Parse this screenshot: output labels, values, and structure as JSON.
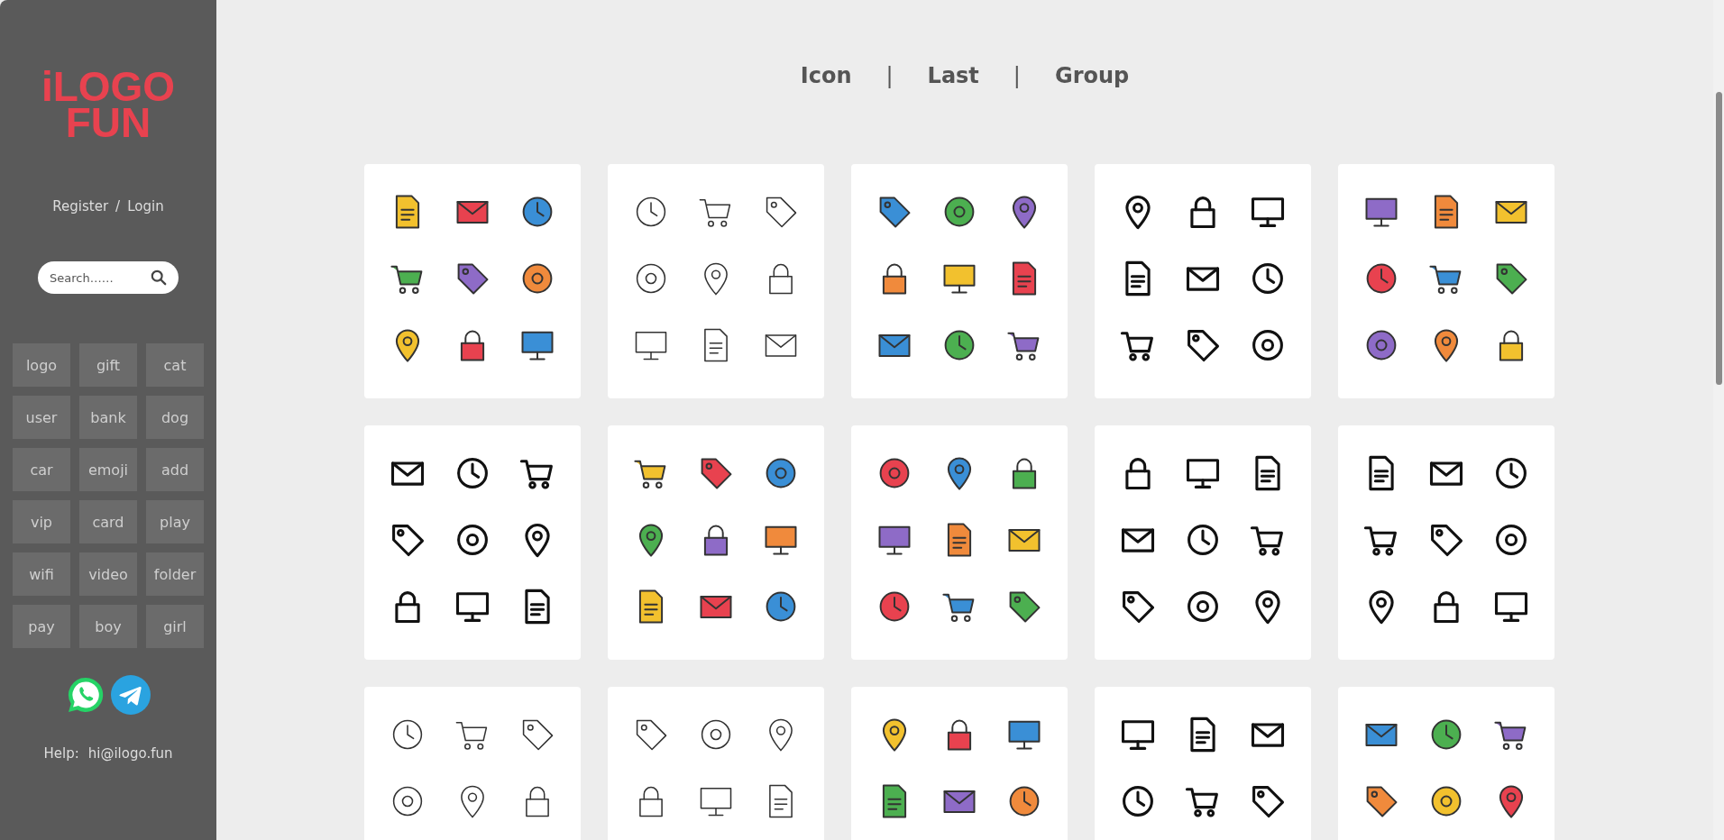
{
  "sidebar": {
    "logo": [
      "iLOGO",
      "FUN"
    ],
    "account": {
      "register": "Register",
      "separator": "/",
      "login": "Login"
    },
    "search": {
      "placeholder": "Search……"
    },
    "tags": [
      "logo",
      "gift",
      "cat",
      "user",
      "bank",
      "dog",
      "car",
      "emoji",
      "add",
      "vip",
      "card",
      "play",
      "wifi",
      "video",
      "folder",
      "pay",
      "boy",
      "girl"
    ],
    "help": {
      "label": "Help:",
      "email": "hi@ilogo.fun"
    }
  },
  "nav": [
    {
      "label": "Icon"
    },
    {
      "kind": "separator",
      "label": "|"
    },
    {
      "label": "Last"
    },
    {
      "kind": "separator",
      "label": "|"
    },
    {
      "label": "Group"
    }
  ],
  "icon_cards": [
    {
      "kind": "color"
    },
    {
      "kind": "thin"
    },
    {
      "kind": "color"
    },
    {
      "kind": "bold"
    },
    {
      "kind": "color"
    },
    {
      "kind": "bold"
    },
    {
      "kind": "color"
    },
    {
      "kind": "color"
    },
    {
      "kind": "bold"
    },
    {
      "kind": "bold"
    },
    {
      "kind": "thin"
    },
    {
      "kind": "thin"
    },
    {
      "kind": "color"
    },
    {
      "kind": "bold"
    },
    {
      "kind": "color"
    }
  ]
}
